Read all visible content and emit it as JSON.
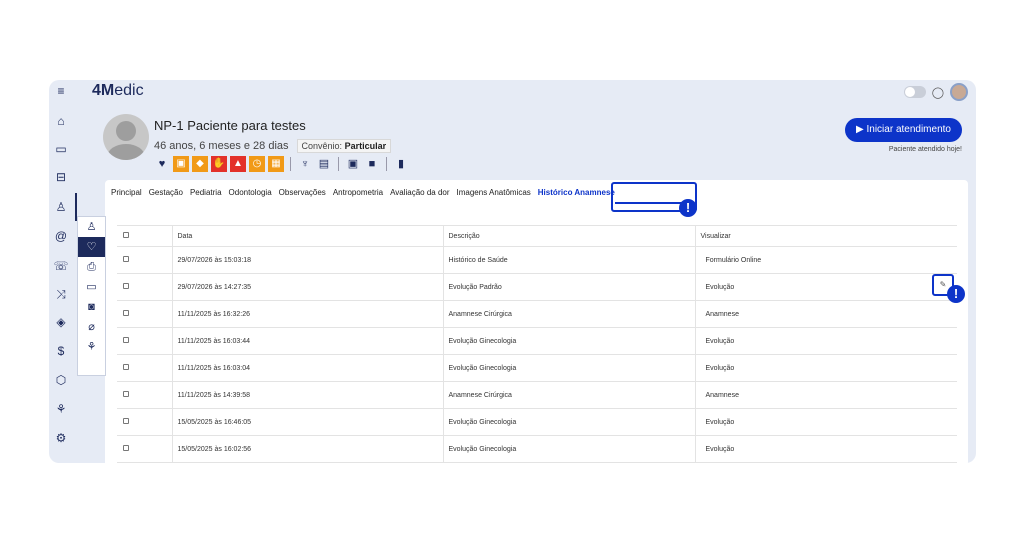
{
  "app": {
    "logo_bold": "4M",
    "logo_rest": "edic"
  },
  "patient": {
    "name": "NP-1 Paciente para testes",
    "age": "46 anos, 6 meses e 28 dias",
    "convenio_label": "Convênio:",
    "convenio_value": "Particular"
  },
  "actions": {
    "start_label": "▶ Iniciar atendimento",
    "attended_note": "Paciente atendido hoje!"
  },
  "tabs": [
    "Principal",
    "Gestação",
    "Pediatria",
    "Odontologia",
    "Observações",
    "Antropometria",
    "Avaliação da dor",
    "Imagens Anatômicas",
    "Histórico Anamnese"
  ],
  "badges": {
    "tab": "!",
    "edit": "!"
  },
  "table": {
    "headers": [
      "Data",
      "Descrição",
      "Visualizar"
    ],
    "rows": [
      {
        "date": "29/07/2026 às 15:03:18",
        "desc": "Histórico de Saúde",
        "view": "Formulário Online"
      },
      {
        "date": "29/07/2026 às 14:27:35",
        "desc": "Evolução Padrão",
        "view": "Evolução"
      },
      {
        "date": "11/11/2025 às 16:32:26",
        "desc": "Anamnese Cirúrgica",
        "view": "Anamnese"
      },
      {
        "date": "11/11/2025 às 16:03:44",
        "desc": "Evolução Ginecologia",
        "view": "Evolução"
      },
      {
        "date": "11/11/2025 às 16:03:04",
        "desc": "Evolução Ginecologia",
        "view": "Evolução"
      },
      {
        "date": "11/11/2025 às 14:39:58",
        "desc": "Anamnese Cirúrgica",
        "view": "Anamnese"
      },
      {
        "date": "15/05/2025 às 16:46:05",
        "desc": "Evolução Ginecologia",
        "view": "Evolução"
      },
      {
        "date": "15/05/2025 às 16:02:56",
        "desc": "Evolução Ginecologia",
        "view": "Evolução"
      }
    ]
  },
  "colors": {
    "accent": "#0d34c9",
    "navy": "#1d2a5c",
    "alert_orange": "#f19a17",
    "alert_red": "#e3312a",
    "background": "#e6ebf5"
  },
  "icons": {
    "rail": [
      "menu-icon",
      "home-icon",
      "calendar-icon",
      "car-icon",
      "patient-icon",
      "at-icon",
      "phone-icon",
      "shuffle-icon",
      "tag-icon",
      "dollar-icon",
      "box-icon",
      "chart-icon",
      "settings-icon"
    ],
    "subnav": [
      "person-icon",
      "heartbeat-icon",
      "print-icon",
      "folder-icon",
      "camera-icon",
      "clip-icon",
      "chart-icon"
    ]
  }
}
